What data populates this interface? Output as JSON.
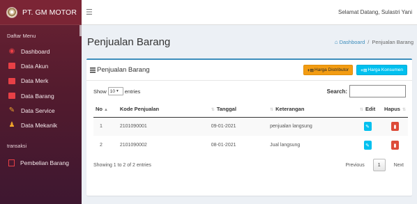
{
  "brand": {
    "name": "PT. GM MOTOR"
  },
  "sidebar": {
    "menu_header": "Daftar Menu",
    "items": [
      {
        "label": "Dashboard",
        "icon": "dashboard-icon"
      },
      {
        "label": "Data Akun",
        "icon": "folder-icon"
      },
      {
        "label": "Data Merk",
        "icon": "folder-icon"
      },
      {
        "label": "Data Barang",
        "icon": "folder-icon"
      },
      {
        "label": "Data Service",
        "icon": "wrench-icon"
      },
      {
        "label": "Data Mekanik",
        "icon": "people-icon"
      }
    ],
    "section_label": "transaksi",
    "section_items": [
      {
        "label": "Pembelian Barang",
        "icon": "file-icon"
      }
    ]
  },
  "topbar": {
    "menu_icon": "☰",
    "greeting": "Selamat Datang, Sulastri Yani"
  },
  "header": {
    "title": "Penjualan Barang",
    "breadcrumb_home": "Dashboard",
    "breadcrumb_sep": "/",
    "breadcrumb_current": "Penjualan Barang"
  },
  "box": {
    "title": "Penjualan Barang",
    "btn_distributor": "Harga Distributor",
    "btn_konsumen": "Harga Konsumen"
  },
  "controls": {
    "show_prefix": "Show",
    "length_value": "10",
    "show_suffix": "entries",
    "search_label": "Search:"
  },
  "table": {
    "columns": [
      "No",
      "Kode Penjualan",
      "Tanggal",
      "Keterangan",
      "Edit",
      "Hapus"
    ],
    "rows": [
      {
        "no": "1",
        "kode": "2101090001",
        "tanggal": "09-01-2021",
        "keterangan": "penjualan langsung"
      },
      {
        "no": "2",
        "kode": "2101090002",
        "tanggal": "08-01-2021",
        "keterangan": "Jual langsung"
      }
    ]
  },
  "footer": {
    "info": "Showing 1 to 2 of 2 entries",
    "prev": "Previous",
    "page": "1",
    "next": "Next"
  },
  "colors": {
    "sidebar": "#531b2e",
    "primary": "#3c8dbc",
    "warning": "#f39c12",
    "info": "#00c0ef",
    "danger": "#dd4b39"
  }
}
